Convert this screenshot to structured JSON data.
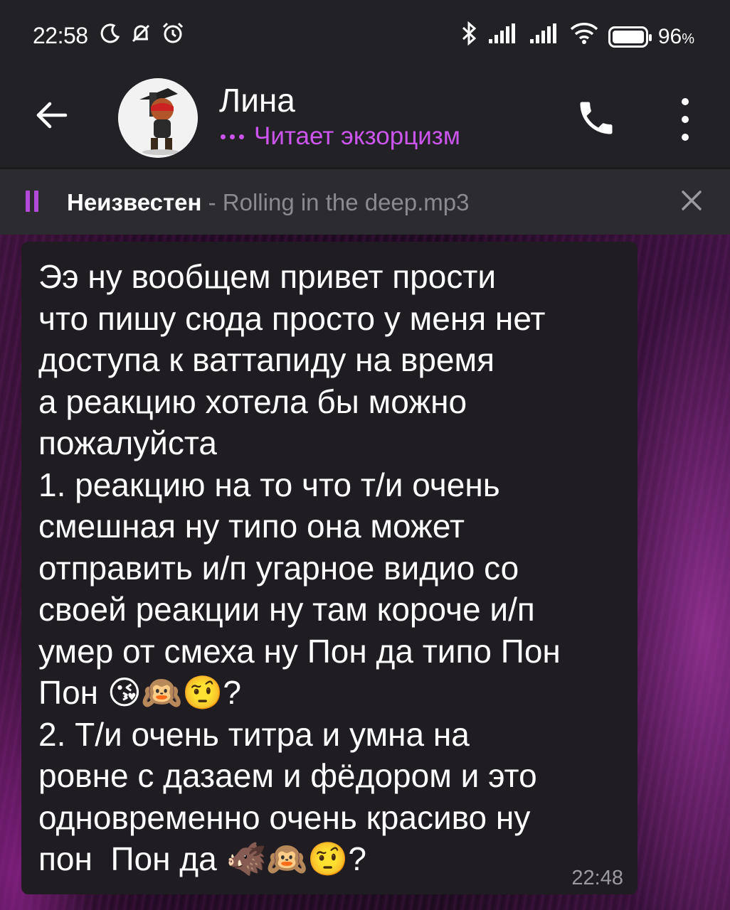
{
  "status_bar": {
    "time": "22:58",
    "battery_percent": "96",
    "battery_suffix": "%",
    "left_icons": [
      "moon-icon",
      "bell-off-icon",
      "alarm-icon"
    ],
    "right_icons": [
      "bluetooth-icon",
      "signal-icon",
      "signal-icon",
      "wifi-icon",
      "battery-icon"
    ]
  },
  "header": {
    "contact_name": "Лина",
    "status_text": "Читает экзорцизм",
    "status_color": "#cc55ee"
  },
  "player": {
    "artist": "Неизвестен",
    "separator": " - ",
    "track": "Rolling in the deep.mp3",
    "accent_color": "#b34ad9"
  },
  "message": {
    "text": "Ээ ну вообщем привет прости\nчто пишу сюда просто у меня нет\nдоступа к ваттапиду на время\nа реакцию хотела бы можно\nпожалуйста\n1. реакцию на то что т/и очень\nсмешная ну типо она может\nотправить и/п угарное видио со\nсвоей реакции ну там короче и/п\nумер от смеха ну Пон да типо Пон\nПон 😘🙉🤨?\n2. Т/и очень титра и умна на\nровне с дазаем и фёдором и это\nодновременно очень красиво ну\nпон  Пон да 🐗🙉🤨?",
    "time": "22:48"
  }
}
